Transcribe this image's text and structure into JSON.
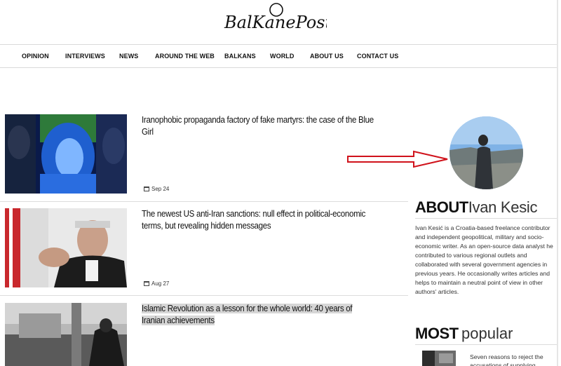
{
  "logo": {
    "text": "BalKanePost"
  },
  "nav": {
    "items": [
      "OPINION",
      "INTERVIEWS",
      "NEWS",
      "AROUND THE WEB",
      "BALKANS",
      "WORLD",
      "ABOUT US",
      "CONTACT US"
    ]
  },
  "articles": [
    {
      "title": "Iranophobic propaganda factory of fake martyrs: the case of the Blue Girl",
      "date": "Sep 24"
    },
    {
      "title": "The newest US anti-Iran sanctions: null effect in political-economic terms, but revealing hidden messages",
      "date": "Aug 27"
    },
    {
      "title": "Islamic Revolution as a lesson for the whole world: 40 years of Iranian achievements",
      "date": ""
    }
  ],
  "sidebar": {
    "about_bold": "ABOUT",
    "about_name": "Ivan Kesic",
    "about_text": "Ivan Kesić is a Croatia-based freelance contributor and independent geopolitical, military and socio-economic writer. As an open-source data analyst he contributed to various regional outlets and collaborated with several government agencies in previous years. He occasionally writes articles and helps to maintain a neutral point of view in other authors' articles.",
    "popular_bold": "MOST",
    "popular_light": "popular",
    "popular_item": "Seven reasons to reject the accusations of supplying"
  },
  "colors": {
    "arrow": "#d0121b",
    "divider": "#dcdcdc"
  }
}
